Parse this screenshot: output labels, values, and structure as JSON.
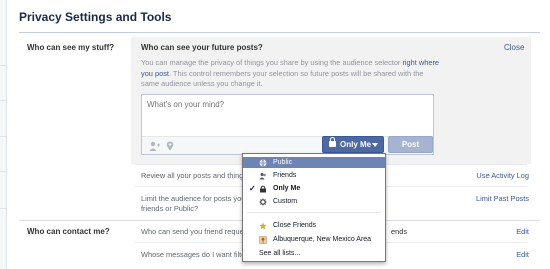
{
  "page": {
    "title": "Privacy Settings and Tools"
  },
  "sections": {
    "stuff": {
      "label": "Who can see my stuff?"
    },
    "contact": {
      "label": "Who can contact me?"
    }
  },
  "panel": {
    "heading": "Who can see your future posts?",
    "close": "Close",
    "desc_pre": "You can manage the privacy of things you share by using the audience selector",
    "desc_link": "right where you post",
    "desc_post": ". This control remembers your selection so future posts will be shared with the same audience unless you change it.",
    "composer_placeholder": "What's on your mind?",
    "audience_label": "Only Me",
    "post_label": "Post"
  },
  "rows": {
    "review": {
      "text": "Review all your posts and things",
      "link": "Use Activity Log"
    },
    "limit": {
      "line1": "Limit the audience for posts you",
      "line2": "friends or Public?",
      "link": "Limit Past Posts"
    },
    "friend_req": {
      "text": "Who can send you friend reques",
      "tail": "ends",
      "link": "Edit"
    },
    "messages": {
      "text": "Whose messages do I want filte",
      "link": "Edit"
    }
  },
  "menu": {
    "items": [
      {
        "label": "Public",
        "icon": "globe-icon",
        "selected": false,
        "highlighted": true
      },
      {
        "label": "Friends",
        "icon": "friends-icon",
        "selected": false,
        "highlighted": false
      },
      {
        "label": "Only Me",
        "icon": "lock-icon",
        "selected": true,
        "highlighted": false
      },
      {
        "label": "Custom",
        "icon": "gear-icon",
        "selected": false,
        "highlighted": false
      },
      {
        "label": "Close Friends",
        "icon": "star-icon",
        "selected": false,
        "highlighted": false
      },
      {
        "label": "Albuquerque, New Mexico Area",
        "icon": "location-icon",
        "selected": false,
        "highlighted": false
      },
      {
        "label": "See all lists...",
        "icon": "",
        "selected": false,
        "highlighted": false
      }
    ],
    "check": "✓"
  },
  "colors": {
    "accent": "#3b5998",
    "button": "#4e69a2",
    "highlight": "#6d84b4"
  }
}
